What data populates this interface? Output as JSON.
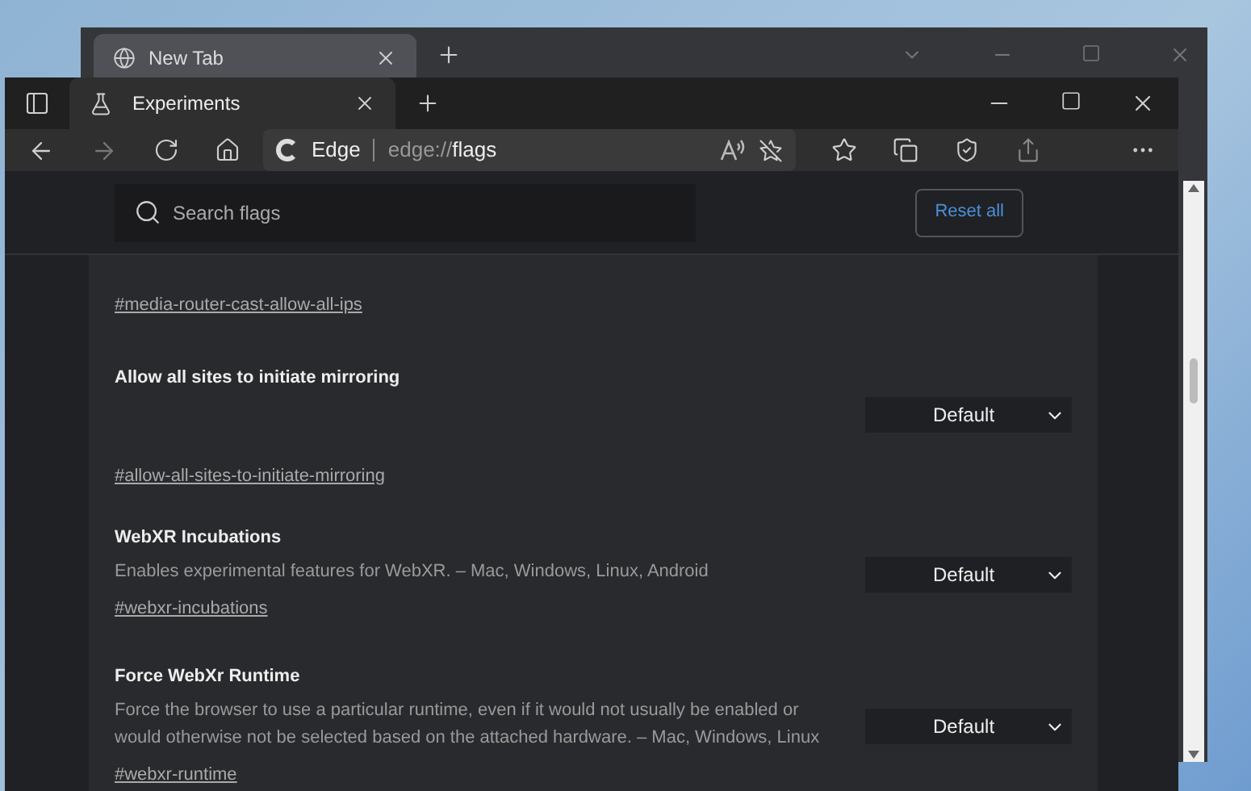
{
  "back_window": {
    "tabs": [
      {
        "label": "New Tab",
        "selected": true
      }
    ]
  },
  "window": {
    "tabs": [
      {
        "label": "Experiments",
        "selected": true
      }
    ]
  },
  "address_bar": {
    "site": "Edge",
    "url_prefix": "edge://",
    "url_path": "flags"
  },
  "search": {
    "placeholder": "Search flags"
  },
  "reset_button": "Reset all",
  "flags": [
    {
      "kind": "link_only",
      "link": "#media-router-cast-allow-all-ips"
    },
    {
      "kind": "select",
      "title": "Allow all sites to initiate mirroring",
      "value": "Default",
      "link": "#allow-all-sites-to-initiate-mirroring"
    },
    {
      "kind": "select",
      "title": "WebXR Incubations",
      "lines": [
        "Enables experimental features for WebXR. – Mac, Windows, Linux, Android"
      ],
      "value": "Default",
      "link": "#webxr-incubations"
    },
    {
      "kind": "select",
      "title": "Force WebXr Runtime",
      "lines": [
        "Force the browser to use a particular runtime, even if it would not usually be enabled or",
        "would otherwise not be selected based on the attached hardware. – Mac, Windows, Linux"
      ],
      "value": "Default",
      "link": "#webxr-runtime"
    }
  ]
}
